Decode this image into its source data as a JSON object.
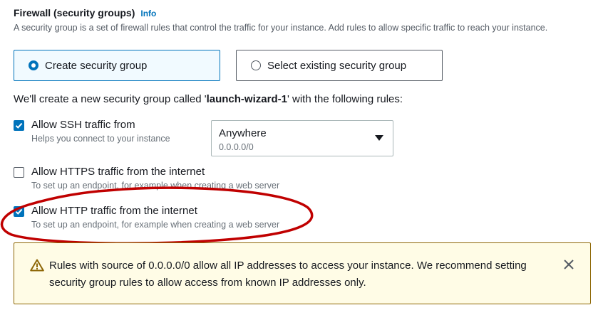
{
  "section": {
    "title": "Firewall (security groups)",
    "info_link": "Info",
    "description": "A security group is a set of firewall rules that control the traffic for your instance. Add rules to allow specific traffic to reach your instance."
  },
  "options": {
    "create": {
      "label": "Create security group",
      "selected": true
    },
    "existing": {
      "label": "Select existing security group",
      "selected": false
    }
  },
  "intro": {
    "prefix": "We'll create a new security group called '",
    "group_name": "launch-wizard-1",
    "suffix": "' with the following rules:"
  },
  "rules": [
    {
      "label": "Allow SSH traffic from",
      "description": "Helps you connect to your instance",
      "checked": true
    },
    {
      "label": "Allow HTTPS traffic from the internet",
      "description": "To set up an endpoint, for example when creating a web server",
      "checked": false
    },
    {
      "label": "Allow HTTP traffic from the internet",
      "description": "To set up an endpoint, for example when creating a web server",
      "checked": true
    }
  ],
  "ssh_source": {
    "value": "Anywhere",
    "sub": "0.0.0.0/0"
  },
  "alert": {
    "text": "Rules with source of 0.0.0.0/0 allow all IP addresses to access your instance. We recommend setting security group rules to allow access from known IP addresses only."
  },
  "colors": {
    "accent": "#0073bb",
    "warning": "#8d6605",
    "annotation": "#c00000"
  },
  "icons": {
    "alert": "warning-icon",
    "close": "close-icon",
    "select": "caret-down-icon",
    "check": "checkmark-icon"
  }
}
